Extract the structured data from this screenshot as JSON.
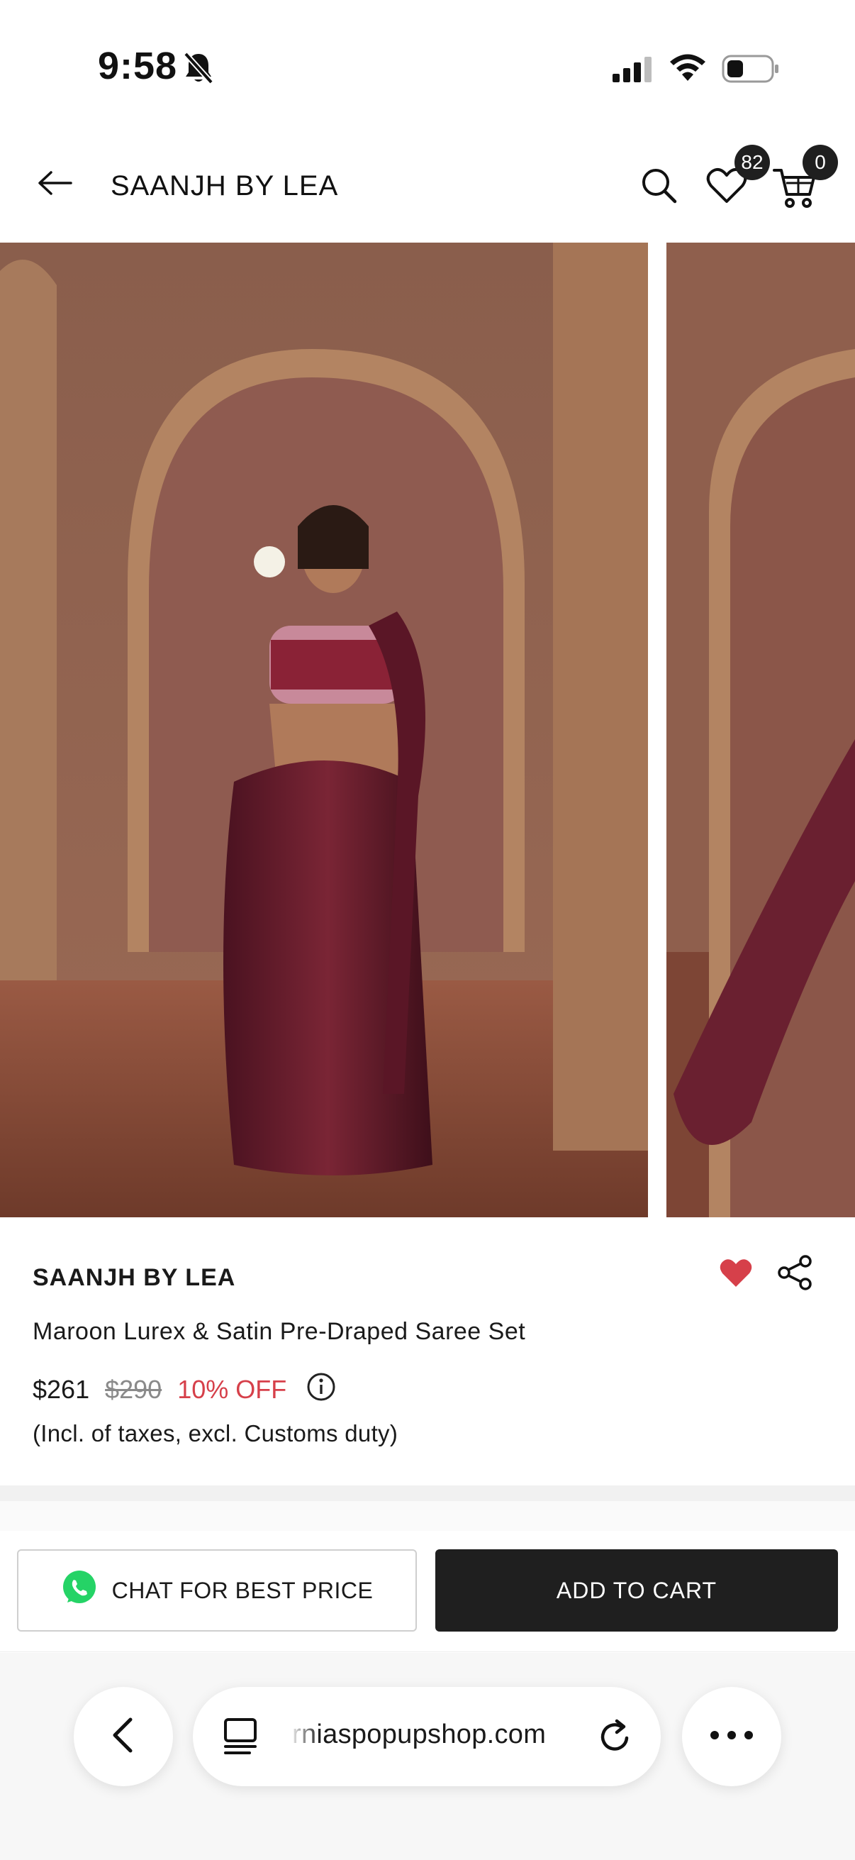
{
  "status_bar": {
    "time": "9:58"
  },
  "header": {
    "title": "SAANJH BY LEA",
    "wishlist_count": "82",
    "cart_count": "0"
  },
  "product": {
    "brand": "SAANJH BY LEA",
    "name": "Maroon Lurex & Satin Pre-Draped Saree Set",
    "price": "$261",
    "original_price": "$290",
    "discount": "10% OFF",
    "tax_note": "(Incl. of taxes, excl. Customs duty)",
    "favorited": true
  },
  "actions": {
    "chat_label": "CHAT FOR BEST PRICE",
    "add_to_cart_label": "ADD TO CART"
  },
  "browser": {
    "url": "rniaspopupshop.com"
  },
  "colors": {
    "accent_red": "#d6404a",
    "dark_button": "#1f1f1f",
    "whatsapp_green": "#25d366"
  }
}
